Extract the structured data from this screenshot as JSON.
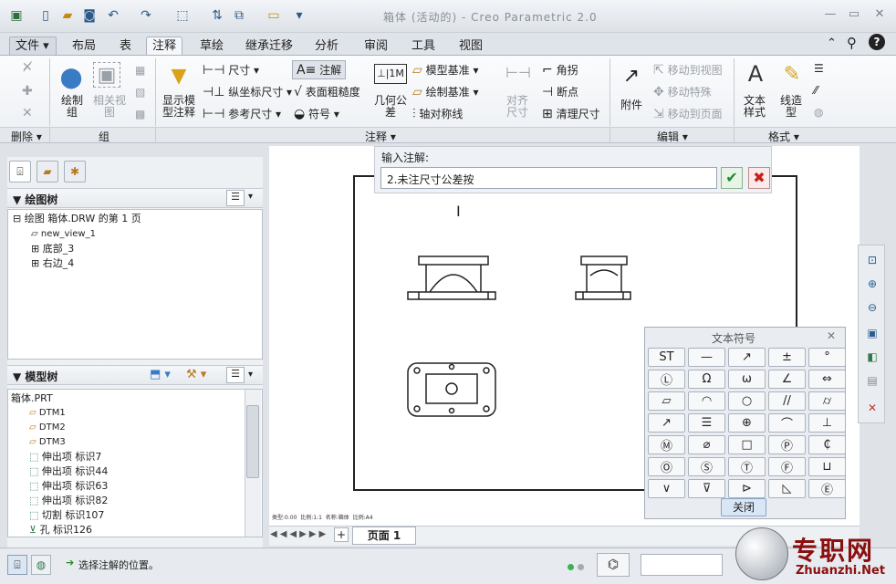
{
  "title_bar": {
    "title": "箱体 (活动的) - Creo Parametric 2.0"
  },
  "tabs": [
    "文件",
    "布局",
    "表",
    "注释",
    "草绘",
    "继承迁移",
    "分析",
    "审阅",
    "工具",
    "视图"
  ],
  "ribbon": {
    "delete_group": {
      "label": "删除"
    },
    "group_group": {
      "label": "组",
      "draw_group": "绘制组",
      "related_view": "相关视图"
    },
    "annotation_group": {
      "label": "注释",
      "show_model_annotation": "显示模型注释",
      "dimension": "尺寸",
      "ordinate_dimension": "纵坐标尺寸",
      "reference_dimension": "参考尺寸",
      "note": "注解",
      "surface_finish": "表面粗糙度",
      "symbol": "符号",
      "geometric_tolerance": "几何公差",
      "model_datum": "模型基准",
      "draw_datum": "绘制基准",
      "axis_symmetry": "轴对称线",
      "align_dimension": "对齐尺寸",
      "angle": "角拐",
      "breakpoint": "断点",
      "cleanup_dimension": "清理尺寸"
    },
    "edit_group": {
      "label": "编辑",
      "attachment": "附件",
      "move_to_view": "移动到视图",
      "move_special": "移动特殊",
      "move_to_page": "移动到页面"
    },
    "format_group": {
      "label": "格式",
      "text_style": "文本样式",
      "line_style": "线造型"
    }
  },
  "left_panel": {
    "drawing_tree": {
      "header": "绘图树",
      "items": [
        "绘图 箱体.DRW 的第 1 页",
        "new_view_1",
        "底部_3",
        "右边_4"
      ]
    },
    "model_tree": {
      "header": "模型树",
      "root": "箱体.PRT",
      "items": [
        "DTM1",
        "DTM2",
        "DTM3",
        "伸出项 标识7",
        "伸出项 标识44",
        "伸出项 标识63",
        "伸出项 标识82",
        "切割 标识107",
        "孔 标识126"
      ]
    }
  },
  "note_input": {
    "label": "输入注解:",
    "value": "2.未注尺寸公差按"
  },
  "symbol_palette": {
    "title": "文本符号",
    "close_label": "关闭",
    "symbols": [
      "ST",
      "—",
      "↗",
      "±",
      "°",
      "Ⓛ",
      "Ω",
      "ω",
      "∠",
      "⇔",
      "▱",
      "◠",
      "○",
      "//",
      "⌭",
      "↗",
      "☰",
      "⊕",
      "⌒",
      "⊥",
      "Ⓜ",
      "⌀",
      "□",
      "Ⓟ",
      "₵",
      "Ⓞ",
      "Ⓢ",
      "Ⓣ",
      "Ⓕ",
      "⊔",
      "∨",
      "⊽",
      "⊳",
      "◺",
      "Ⓔ"
    ]
  },
  "page_tabs": {
    "current": "页面 1"
  },
  "sheet_labels": [
    "类型:0.00",
    "比例:1:1",
    "名称:箱体",
    "比例:A4"
  ],
  "status": {
    "message": "选择注解的位置。"
  },
  "watermark": {
    "cn": "专职网",
    "en": "Zhuanzhi.Net"
  }
}
